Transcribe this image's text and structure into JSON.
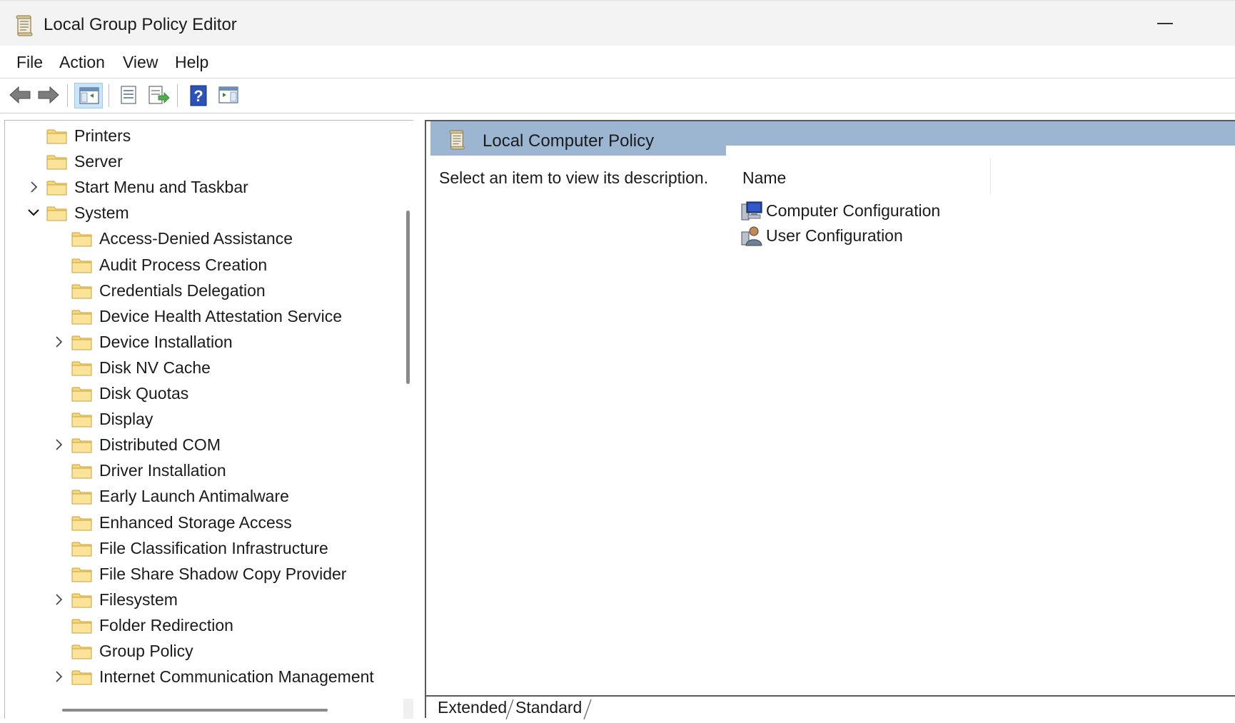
{
  "window": {
    "title": "Local Group Policy Editor"
  },
  "menu": [
    "File",
    "Action",
    "View",
    "Help"
  ],
  "toolbar": {
    "buttons": [
      "back-arrow-icon",
      "forward-arrow-icon",
      "show-hide-tree-icon",
      "properties-icon",
      "export-list-icon",
      "help-icon",
      "action-pane-icon"
    ]
  },
  "tree": {
    "items": [
      {
        "label": "Printers",
        "indent": 0,
        "expander": "none"
      },
      {
        "label": "Server",
        "indent": 0,
        "expander": "none"
      },
      {
        "label": "Start Menu and Taskbar",
        "indent": 0,
        "expander": "collapsed"
      },
      {
        "label": "System",
        "indent": 0,
        "expander": "expanded"
      },
      {
        "label": "Access-Denied Assistance",
        "indent": 1,
        "expander": "none"
      },
      {
        "label": "Audit Process Creation",
        "indent": 1,
        "expander": "none"
      },
      {
        "label": "Credentials Delegation",
        "indent": 1,
        "expander": "none"
      },
      {
        "label": "Device Health Attestation Service",
        "indent": 1,
        "expander": "none"
      },
      {
        "label": "Device Installation",
        "indent": 1,
        "expander": "collapsed"
      },
      {
        "label": "Disk NV Cache",
        "indent": 1,
        "expander": "none"
      },
      {
        "label": "Disk Quotas",
        "indent": 1,
        "expander": "none"
      },
      {
        "label": "Display",
        "indent": 1,
        "expander": "none"
      },
      {
        "label": "Distributed COM",
        "indent": 1,
        "expander": "collapsed"
      },
      {
        "label": "Driver Installation",
        "indent": 1,
        "expander": "none"
      },
      {
        "label": "Early Launch Antimalware",
        "indent": 1,
        "expander": "none"
      },
      {
        "label": "Enhanced Storage Access",
        "indent": 1,
        "expander": "none"
      },
      {
        "label": "File Classification Infrastructure",
        "indent": 1,
        "expander": "none"
      },
      {
        "label": "File Share Shadow Copy Provider",
        "indent": 1,
        "expander": "none"
      },
      {
        "label": "Filesystem",
        "indent": 1,
        "expander": "collapsed"
      },
      {
        "label": "Folder Redirection",
        "indent": 1,
        "expander": "none"
      },
      {
        "label": "Group Policy",
        "indent": 1,
        "expander": "none"
      },
      {
        "label": "Internet Communication Management",
        "indent": 1,
        "expander": "collapsed"
      }
    ]
  },
  "right_pane": {
    "header_title": "Local Computer Policy",
    "description": "Select an item to view its description.",
    "column_name": "Name",
    "items": [
      {
        "label": "Computer Configuration",
        "icon": "computer-config-icon"
      },
      {
        "label": "User Configuration",
        "icon": "user-config-icon"
      }
    ],
    "tabs": [
      "Extended",
      "Standard"
    ]
  }
}
